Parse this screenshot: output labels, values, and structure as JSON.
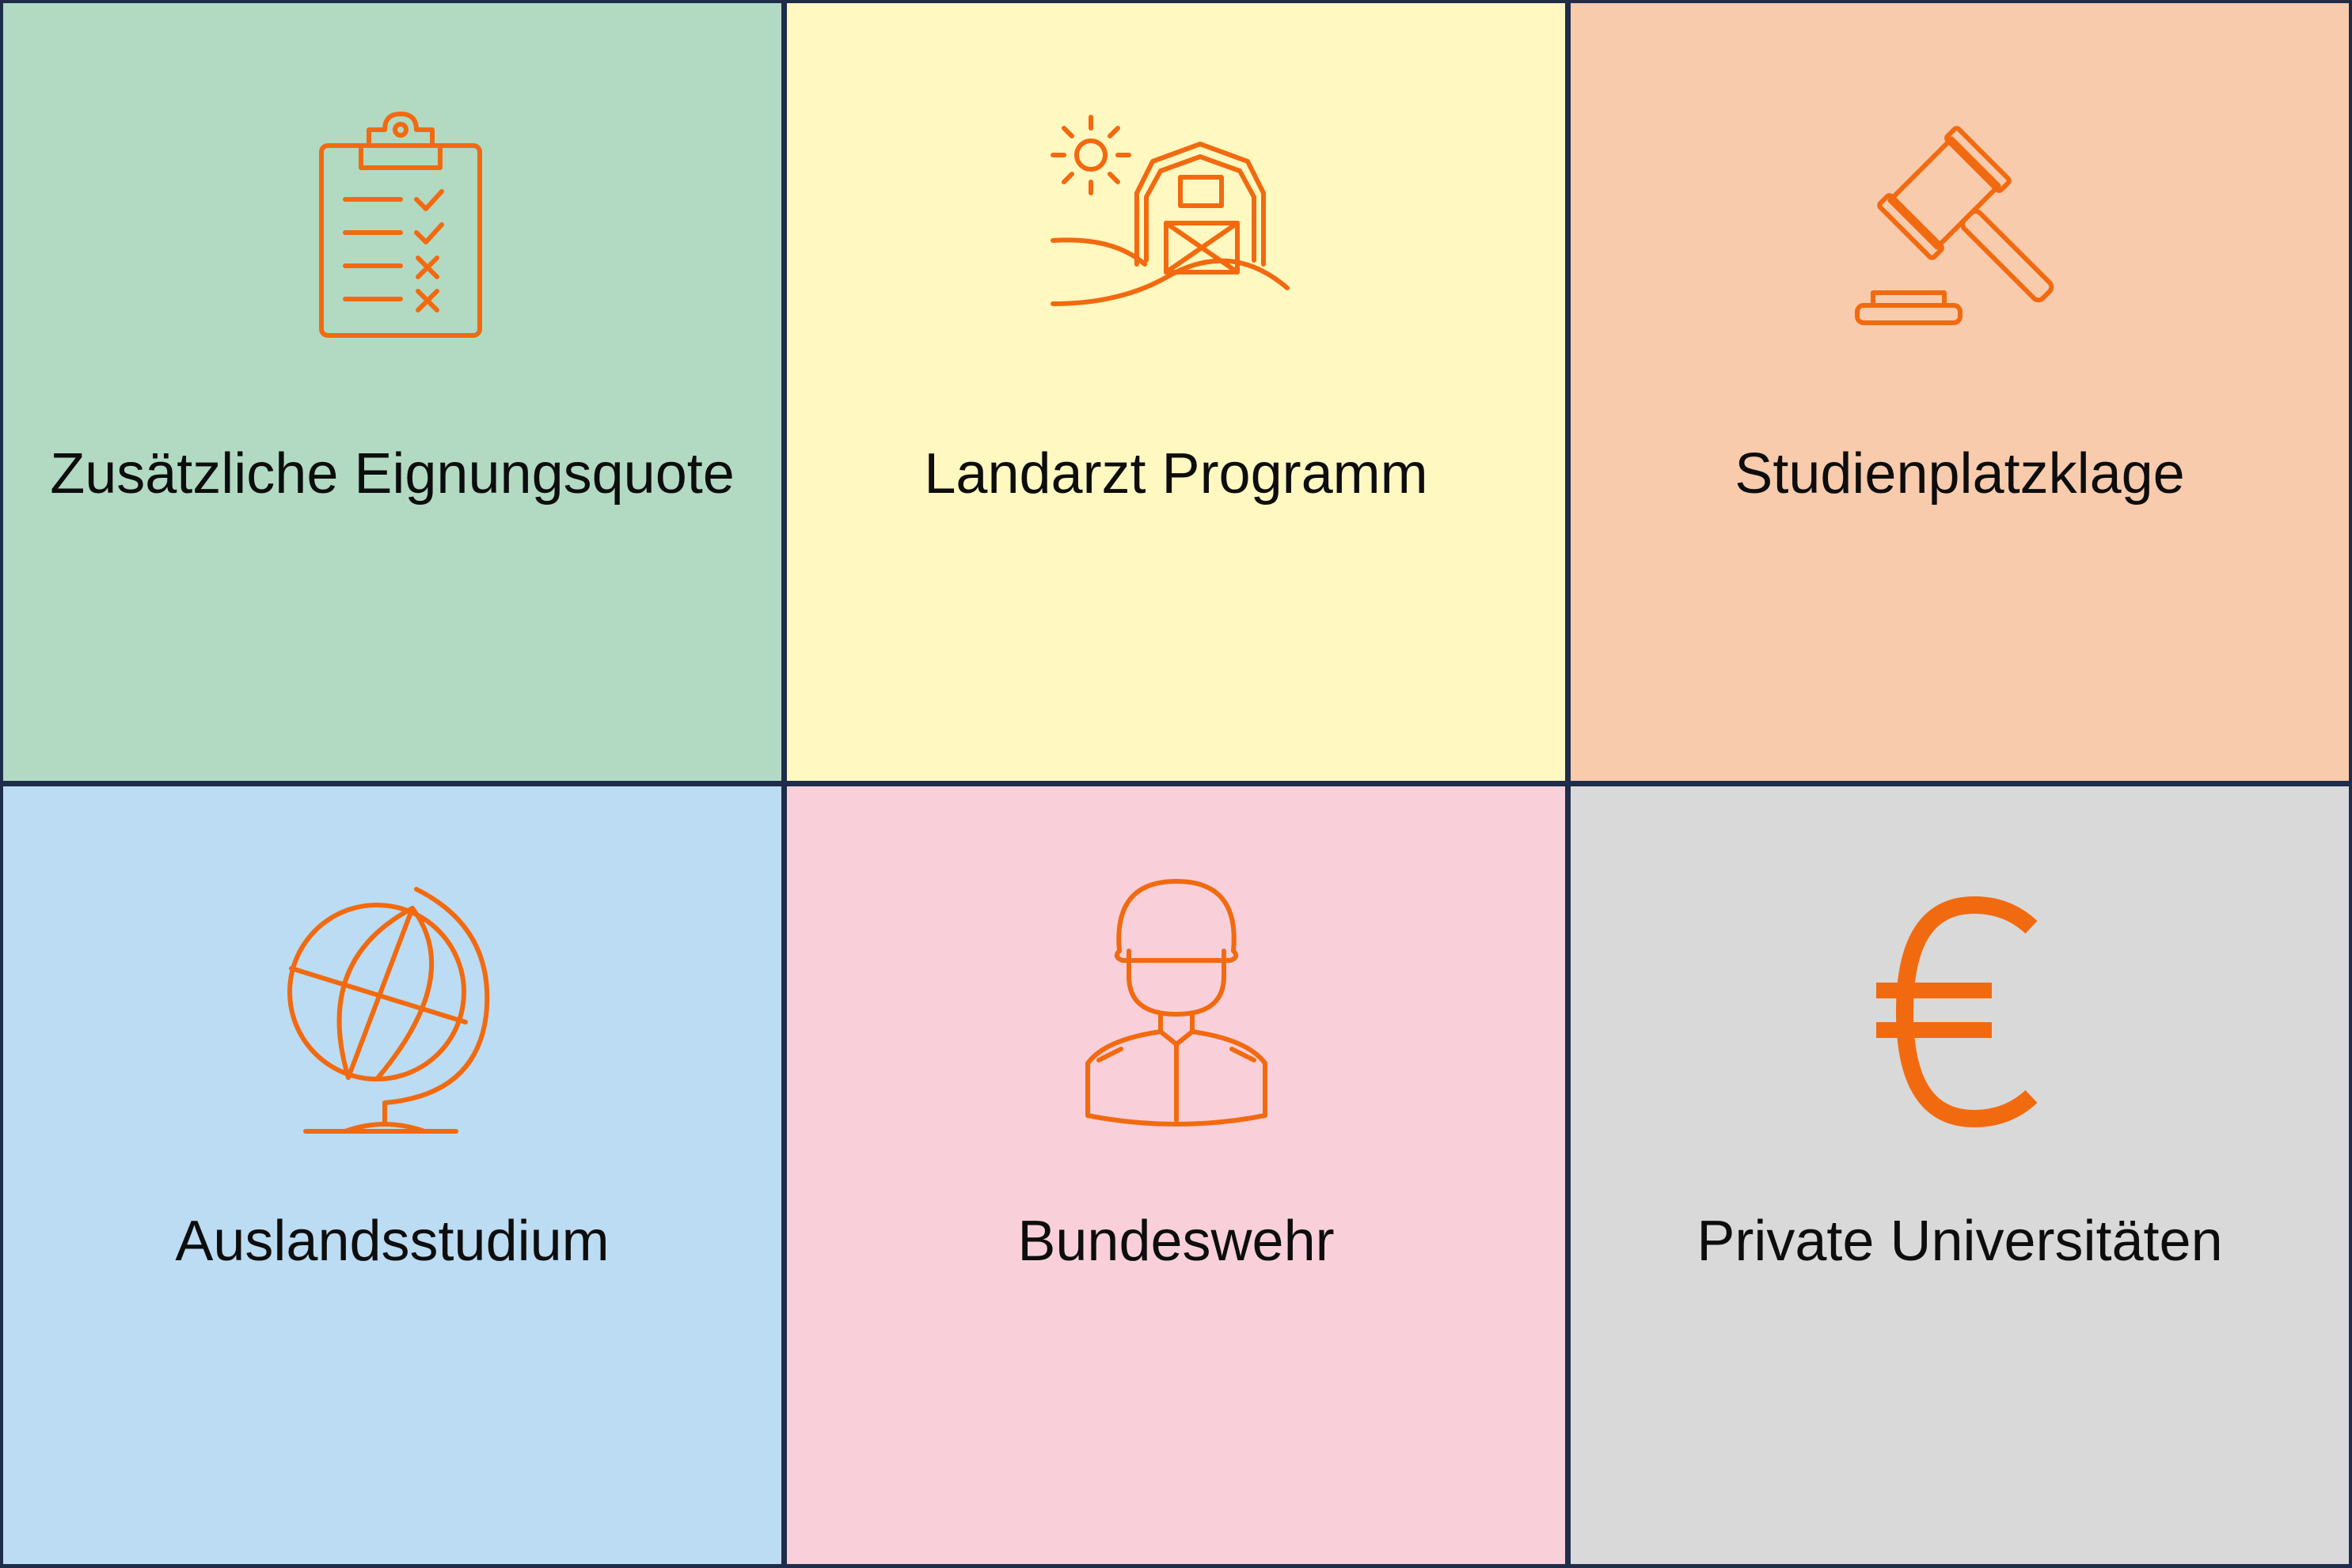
{
  "tiles": [
    {
      "label": "Zusätzliche Eignungsquote",
      "icon": "clipboard-checklist-icon",
      "color": "#b2dac3"
    },
    {
      "label": "Landarzt Programm",
      "icon": "farm-barn-icon",
      "color": "#fff8c0"
    },
    {
      "label": "Studienplatzklage",
      "icon": "gavel-icon",
      "color": "#f8cbad"
    },
    {
      "label": "Auslandsstudium",
      "icon": "globe-icon",
      "color": "#bbdcf3"
    },
    {
      "label": "Bundeswehr",
      "icon": "soldier-icon",
      "color": "#f9d0da"
    },
    {
      "label": "Private Universitäten",
      "icon": "euro-icon",
      "color": "#d9d9d9"
    }
  ],
  "colors": {
    "icon": "#f26a10",
    "border": "#1f2d4a"
  }
}
